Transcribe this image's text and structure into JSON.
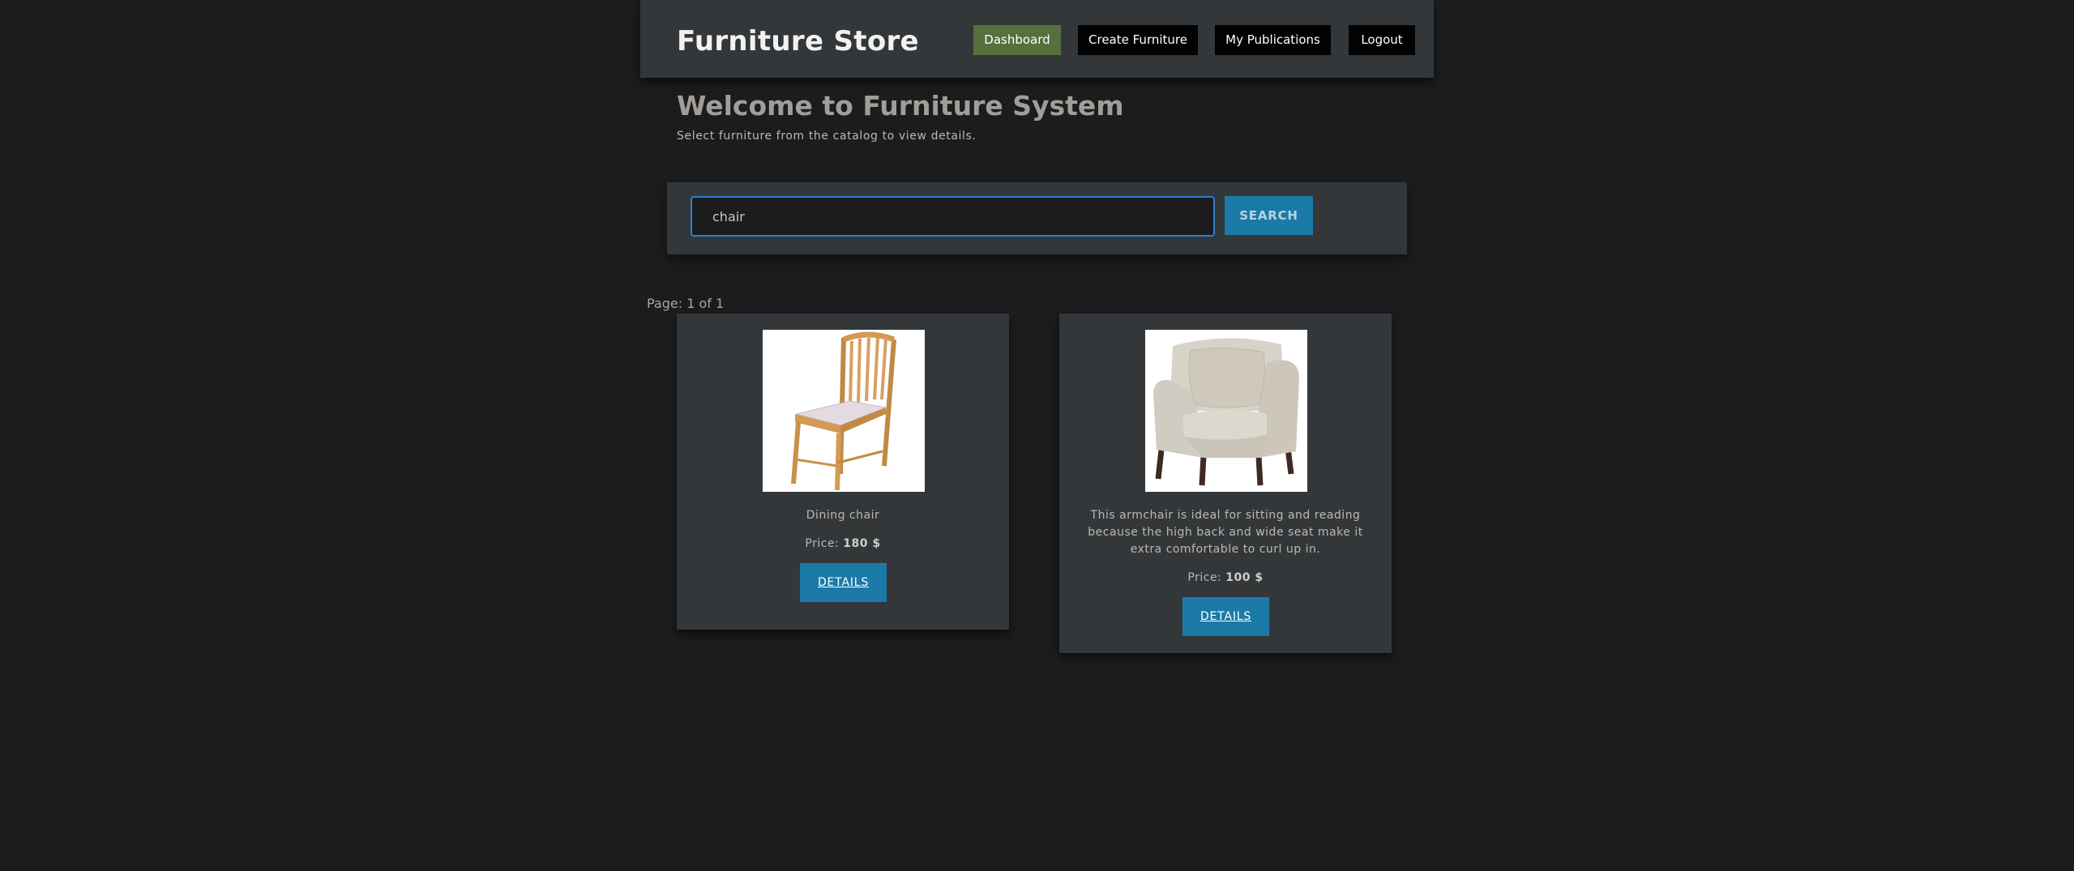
{
  "header": {
    "brand": "Furniture Store",
    "nav": [
      {
        "label": "Dashboard",
        "active": true
      },
      {
        "label": "Create Furniture",
        "active": false
      },
      {
        "label": "My Publications",
        "active": false
      },
      {
        "label": "Logout",
        "active": false
      }
    ]
  },
  "main": {
    "title": "Welcome to Furniture System",
    "subtitle": "Select furniture from the catalog to view details."
  },
  "search": {
    "value": "chair",
    "button_label": "SEARCH"
  },
  "pagination": {
    "text": "Page: 1 of 1"
  },
  "listings": [
    {
      "description": "Dining chair",
      "price_prefix": "Price:",
      "price": "180 $",
      "button_label": "DETAILS",
      "image_icon": "dining-chair-photo"
    },
    {
      "description": "This armchair is ideal for sitting and reading because the high back and wide seat make it extra comfortable to curl up in.",
      "price_prefix": "Price:",
      "price": "100 $",
      "button_label": "DETAILS",
      "image_icon": "armchair-photo"
    }
  ],
  "colors": {
    "background": "#1b1c1e",
    "panel": "#343739",
    "active_nav": "#55703d",
    "accent": "#1c7aa9",
    "focus_border": "#2d7fd8"
  }
}
